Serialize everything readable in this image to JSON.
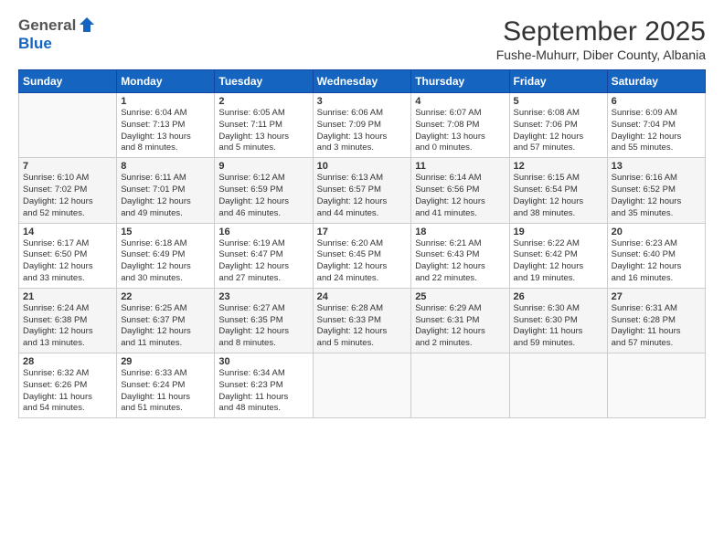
{
  "logo": {
    "general": "General",
    "blue": "Blue"
  },
  "title": "September 2025",
  "subtitle": "Fushe-Muhurr, Diber County, Albania",
  "header_days": [
    "Sunday",
    "Monday",
    "Tuesday",
    "Wednesday",
    "Thursday",
    "Friday",
    "Saturday"
  ],
  "weeks": [
    [
      {
        "day": "",
        "info": ""
      },
      {
        "day": "1",
        "info": "Sunrise: 6:04 AM\nSunset: 7:13 PM\nDaylight: 13 hours\nand 8 minutes."
      },
      {
        "day": "2",
        "info": "Sunrise: 6:05 AM\nSunset: 7:11 PM\nDaylight: 13 hours\nand 5 minutes."
      },
      {
        "day": "3",
        "info": "Sunrise: 6:06 AM\nSunset: 7:09 PM\nDaylight: 13 hours\nand 3 minutes."
      },
      {
        "day": "4",
        "info": "Sunrise: 6:07 AM\nSunset: 7:08 PM\nDaylight: 13 hours\nand 0 minutes."
      },
      {
        "day": "5",
        "info": "Sunrise: 6:08 AM\nSunset: 7:06 PM\nDaylight: 12 hours\nand 57 minutes."
      },
      {
        "day": "6",
        "info": "Sunrise: 6:09 AM\nSunset: 7:04 PM\nDaylight: 12 hours\nand 55 minutes."
      }
    ],
    [
      {
        "day": "7",
        "info": "Sunrise: 6:10 AM\nSunset: 7:02 PM\nDaylight: 12 hours\nand 52 minutes."
      },
      {
        "day": "8",
        "info": "Sunrise: 6:11 AM\nSunset: 7:01 PM\nDaylight: 12 hours\nand 49 minutes."
      },
      {
        "day": "9",
        "info": "Sunrise: 6:12 AM\nSunset: 6:59 PM\nDaylight: 12 hours\nand 46 minutes."
      },
      {
        "day": "10",
        "info": "Sunrise: 6:13 AM\nSunset: 6:57 PM\nDaylight: 12 hours\nand 44 minutes."
      },
      {
        "day": "11",
        "info": "Sunrise: 6:14 AM\nSunset: 6:56 PM\nDaylight: 12 hours\nand 41 minutes."
      },
      {
        "day": "12",
        "info": "Sunrise: 6:15 AM\nSunset: 6:54 PM\nDaylight: 12 hours\nand 38 minutes."
      },
      {
        "day": "13",
        "info": "Sunrise: 6:16 AM\nSunset: 6:52 PM\nDaylight: 12 hours\nand 35 minutes."
      }
    ],
    [
      {
        "day": "14",
        "info": "Sunrise: 6:17 AM\nSunset: 6:50 PM\nDaylight: 12 hours\nand 33 minutes."
      },
      {
        "day": "15",
        "info": "Sunrise: 6:18 AM\nSunset: 6:49 PM\nDaylight: 12 hours\nand 30 minutes."
      },
      {
        "day": "16",
        "info": "Sunrise: 6:19 AM\nSunset: 6:47 PM\nDaylight: 12 hours\nand 27 minutes."
      },
      {
        "day": "17",
        "info": "Sunrise: 6:20 AM\nSunset: 6:45 PM\nDaylight: 12 hours\nand 24 minutes."
      },
      {
        "day": "18",
        "info": "Sunrise: 6:21 AM\nSunset: 6:43 PM\nDaylight: 12 hours\nand 22 minutes."
      },
      {
        "day": "19",
        "info": "Sunrise: 6:22 AM\nSunset: 6:42 PM\nDaylight: 12 hours\nand 19 minutes."
      },
      {
        "day": "20",
        "info": "Sunrise: 6:23 AM\nSunset: 6:40 PM\nDaylight: 12 hours\nand 16 minutes."
      }
    ],
    [
      {
        "day": "21",
        "info": "Sunrise: 6:24 AM\nSunset: 6:38 PM\nDaylight: 12 hours\nand 13 minutes."
      },
      {
        "day": "22",
        "info": "Sunrise: 6:25 AM\nSunset: 6:37 PM\nDaylight: 12 hours\nand 11 minutes."
      },
      {
        "day": "23",
        "info": "Sunrise: 6:27 AM\nSunset: 6:35 PM\nDaylight: 12 hours\nand 8 minutes."
      },
      {
        "day": "24",
        "info": "Sunrise: 6:28 AM\nSunset: 6:33 PM\nDaylight: 12 hours\nand 5 minutes."
      },
      {
        "day": "25",
        "info": "Sunrise: 6:29 AM\nSunset: 6:31 PM\nDaylight: 12 hours\nand 2 minutes."
      },
      {
        "day": "26",
        "info": "Sunrise: 6:30 AM\nSunset: 6:30 PM\nDaylight: 11 hours\nand 59 minutes."
      },
      {
        "day": "27",
        "info": "Sunrise: 6:31 AM\nSunset: 6:28 PM\nDaylight: 11 hours\nand 57 minutes."
      }
    ],
    [
      {
        "day": "28",
        "info": "Sunrise: 6:32 AM\nSunset: 6:26 PM\nDaylight: 11 hours\nand 54 minutes."
      },
      {
        "day": "29",
        "info": "Sunrise: 6:33 AM\nSunset: 6:24 PM\nDaylight: 11 hours\nand 51 minutes."
      },
      {
        "day": "30",
        "info": "Sunrise: 6:34 AM\nSunset: 6:23 PM\nDaylight: 11 hours\nand 48 minutes."
      },
      {
        "day": "",
        "info": ""
      },
      {
        "day": "",
        "info": ""
      },
      {
        "day": "",
        "info": ""
      },
      {
        "day": "",
        "info": ""
      }
    ]
  ]
}
